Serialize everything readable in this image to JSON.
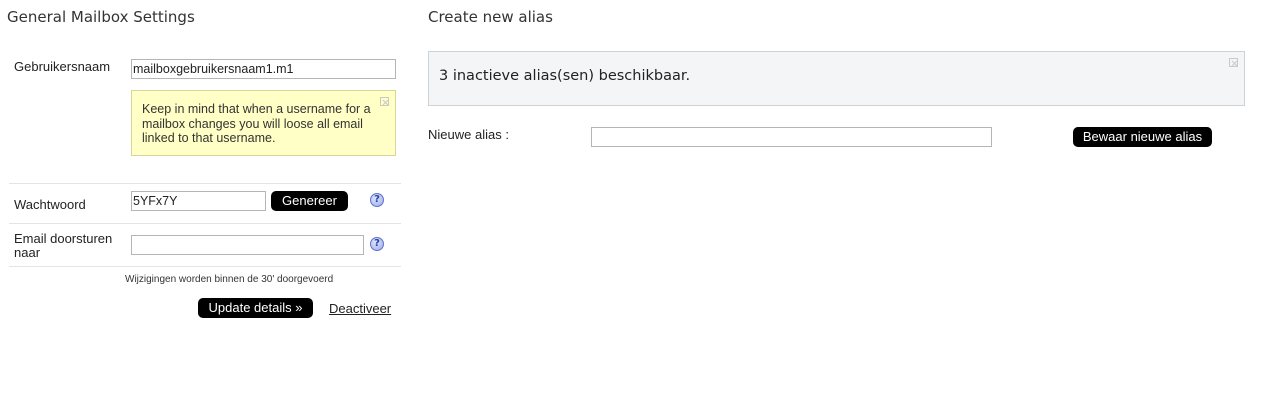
{
  "left": {
    "title": "General Mailbox Settings",
    "username": {
      "label": "Gebruikersnaam",
      "value": "mailboxgebruikersnaam1.m1"
    },
    "warning_note": "Keep in mind that when a username for a mailbox changes you will loose all email linked to that username.",
    "password": {
      "label": "Wachtwoord",
      "value": "5YFx7Y",
      "generate_label": "Genereer",
      "help_icon": "question-help-icon",
      "help_glyph": "?"
    },
    "forward": {
      "label": "Email doorsturen naar",
      "value": "",
      "help_icon": "question-help-icon",
      "help_glyph": "?"
    },
    "notice": "Wijzigingen worden binnen de 30' doorgevoerd",
    "update_label": "Update details »",
    "deactivate_label": "Deactiveer"
  },
  "right": {
    "title": "Create new alias",
    "info_text": "3 inactieve alias(sen) beschikbaar.",
    "new_alias_label": "Nieuwe alias :",
    "new_alias_value": "",
    "save_label": "Bewaar nieuwe alias"
  },
  "colors": {
    "button_bg": "#000000",
    "note_bg": "#ffffc6",
    "panel_bg": "#f4f5f7"
  }
}
